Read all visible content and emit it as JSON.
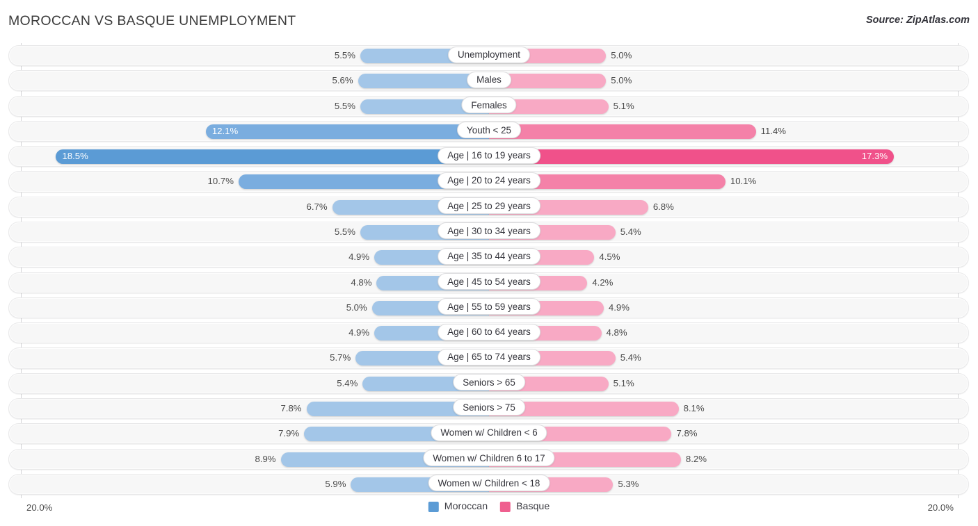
{
  "header": {
    "title": "MOROCCAN VS BASQUE UNEMPLOYMENT",
    "source": "Source: ZipAtlas.com"
  },
  "axis": {
    "left_tick": "20.0%",
    "right_tick": "20.0%",
    "max": 20.0
  },
  "legend": {
    "items": [
      {
        "label": "Moroccan",
        "color": "#5b9bd5"
      },
      {
        "label": "Basque",
        "color": "#ef5f8f"
      }
    ]
  },
  "colors": {
    "left_light": "#a3c6e8",
    "left_mid": "#7aaddf",
    "left_strong": "#5b9bd5",
    "right_light": "#f8a9c4",
    "right_mid": "#f481a8",
    "right_strong": "#f0518a",
    "track": "#f7f7f7",
    "track_border": "#e9e9ea",
    "axis": "#d3d3d6",
    "text": "#4a4a4a"
  },
  "chart_data": {
    "type": "bar",
    "orientation": "horizontal-diverging",
    "title": "MOROCCAN VS BASQUE UNEMPLOYMENT",
    "xlabel": "",
    "ylabel": "",
    "xlim": [
      20.0,
      20.0
    ],
    "grid": false,
    "legend_position": "bottom-center",
    "categories": [
      "Unemployment",
      "Males",
      "Females",
      "Youth < 25",
      "Age | 16 to 19 years",
      "Age | 20 to 24 years",
      "Age | 25 to 29 years",
      "Age | 30 to 34 years",
      "Age | 35 to 44 years",
      "Age | 45 to 54 years",
      "Age | 55 to 59 years",
      "Age | 60 to 64 years",
      "Age | 65 to 74 years",
      "Seniors > 65",
      "Seniors > 75",
      "Women w/ Children < 6",
      "Women w/ Children 6 to 17",
      "Women w/ Children < 18"
    ],
    "series": [
      {
        "name": "Moroccan",
        "color": "#5b9bd5",
        "values": [
          5.5,
          5.6,
          5.5,
          12.1,
          18.5,
          10.7,
          6.7,
          5.5,
          4.9,
          4.8,
          5.0,
          4.9,
          5.7,
          5.4,
          7.8,
          7.9,
          8.9,
          5.9
        ],
        "labels": [
          "5.5%",
          "5.6%",
          "5.5%",
          "12.1%",
          "18.5%",
          "10.7%",
          "6.7%",
          "5.5%",
          "4.9%",
          "4.8%",
          "5.0%",
          "4.9%",
          "5.7%",
          "5.4%",
          "7.8%",
          "7.9%",
          "8.9%",
          "5.9%"
        ]
      },
      {
        "name": "Basque",
        "color": "#ef5f8f",
        "values": [
          5.0,
          5.0,
          5.1,
          11.4,
          17.3,
          10.1,
          6.8,
          5.4,
          4.5,
          4.2,
          4.9,
          4.8,
          5.4,
          5.1,
          8.1,
          7.8,
          8.2,
          5.3
        ],
        "labels": [
          "5.0%",
          "5.0%",
          "5.1%",
          "11.4%",
          "17.3%",
          "10.1%",
          "6.8%",
          "5.4%",
          "4.5%",
          "4.2%",
          "4.9%",
          "4.8%",
          "5.4%",
          "5.1%",
          "8.1%",
          "7.8%",
          "8.2%",
          "5.3%"
        ]
      }
    ]
  }
}
